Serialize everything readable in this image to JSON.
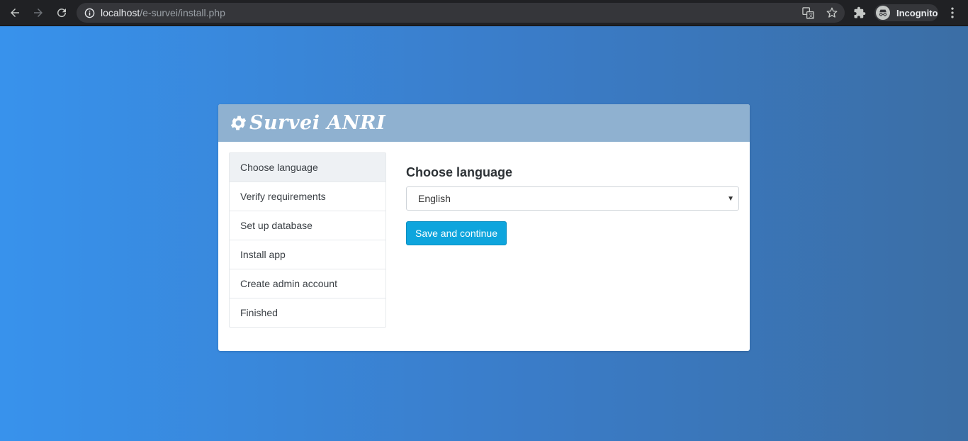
{
  "browser": {
    "url_host": "localhost",
    "url_path": "/e-survei/install.php",
    "profile_label": "Incognito"
  },
  "app": {
    "brand": "Survei ANRI"
  },
  "steps": [
    {
      "label": "Choose language",
      "active": true
    },
    {
      "label": "Verify requirements",
      "active": false
    },
    {
      "label": "Set up database",
      "active": false
    },
    {
      "label": "Install app",
      "active": false
    },
    {
      "label": "Create admin account",
      "active": false
    },
    {
      "label": "Finished",
      "active": false
    }
  ],
  "form": {
    "heading": "Choose language",
    "language_value": "English",
    "submit_label": "Save and continue"
  },
  "colors": {
    "header_bg": "#8fb1d0",
    "button_bg": "#0ea5dd",
    "page_gradient_start": "#3892ec",
    "page_gradient_end": "#3b6ea5"
  }
}
